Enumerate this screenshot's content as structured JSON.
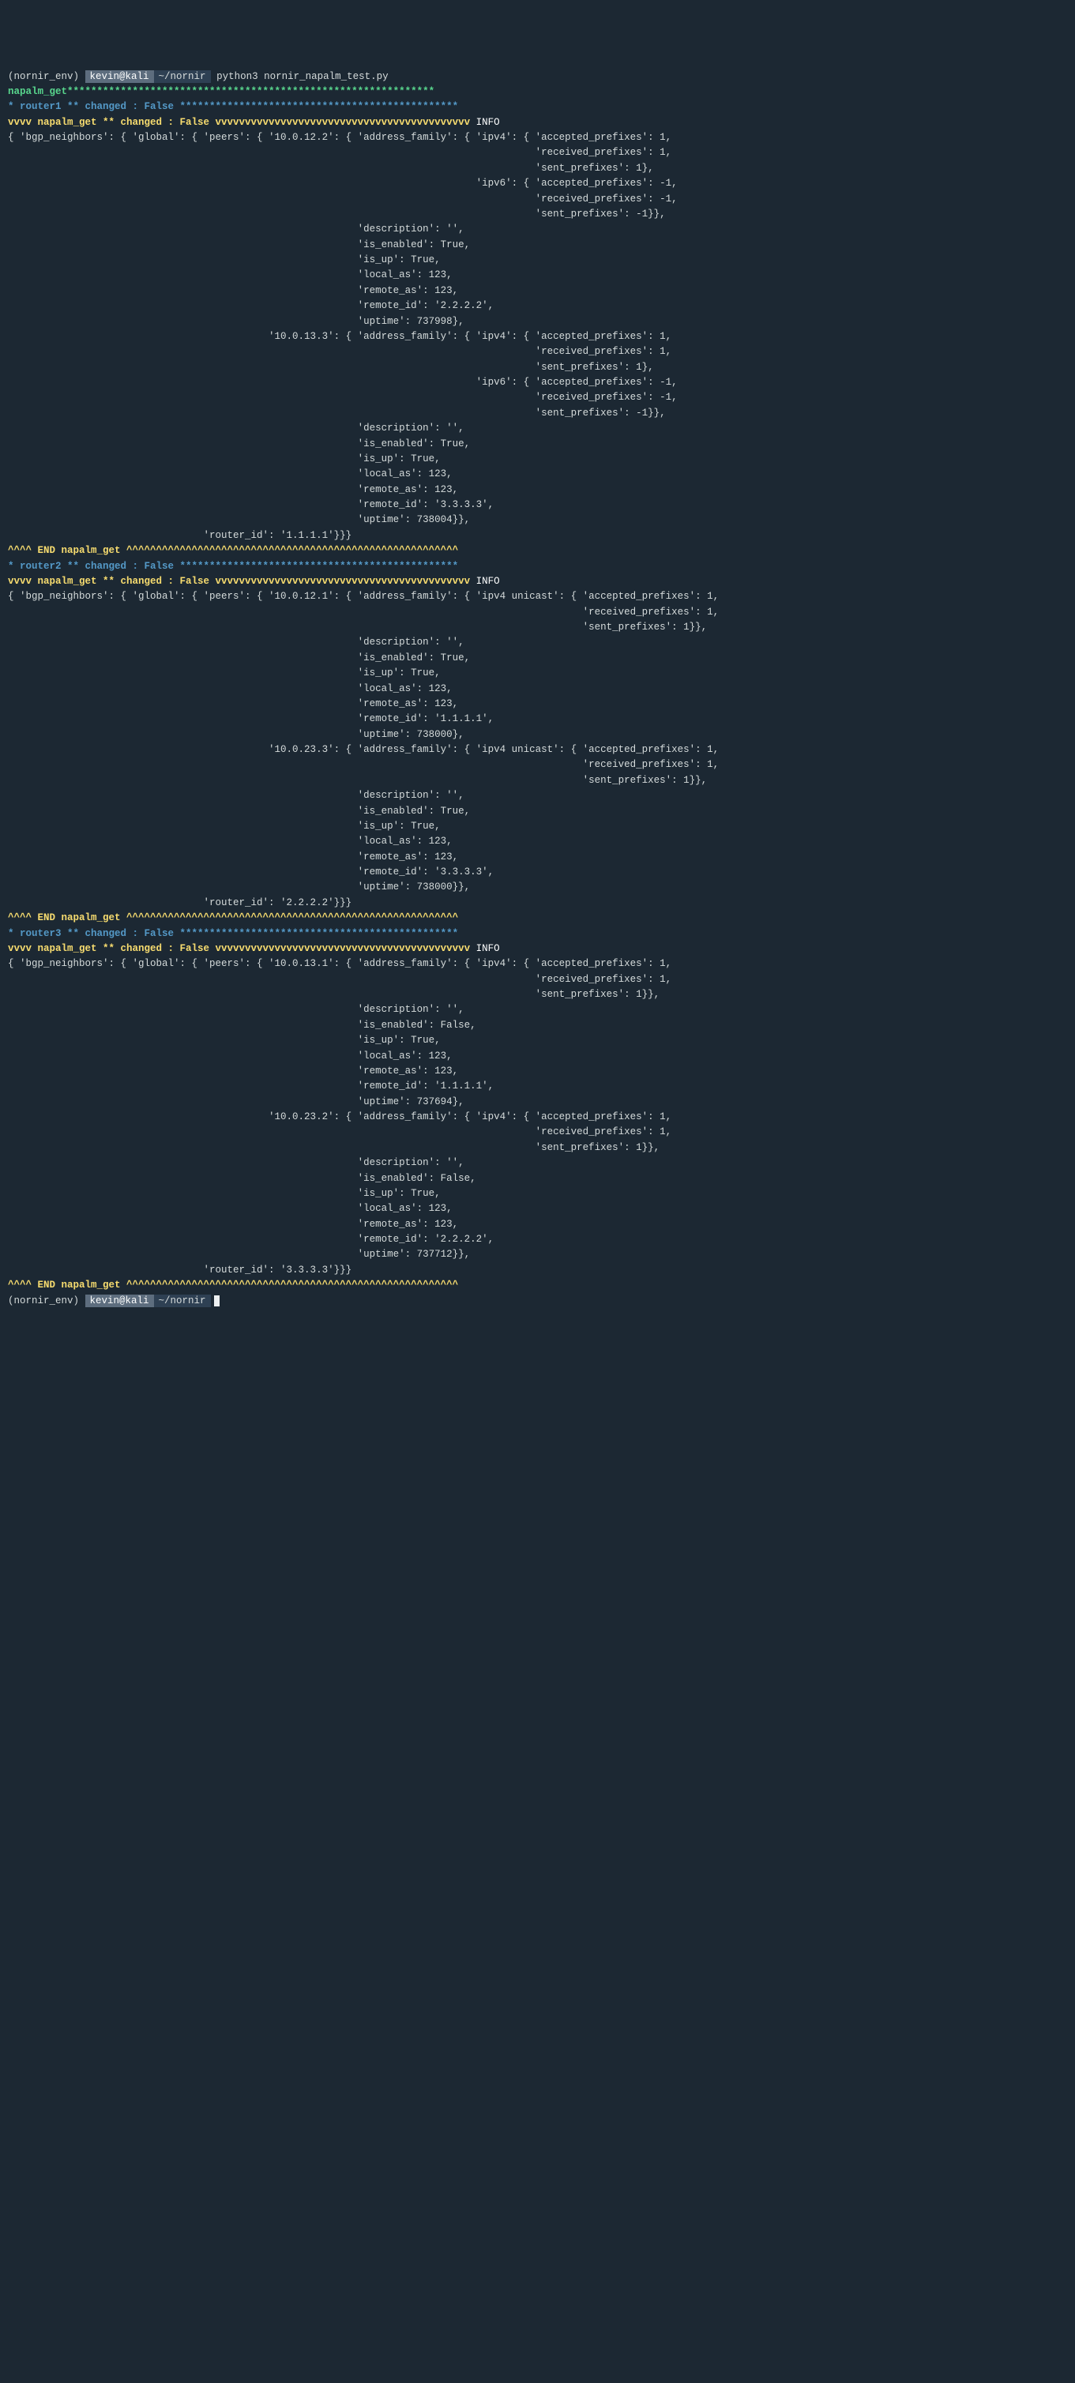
{
  "prompt": {
    "env": "(nornir_env)",
    "user": "kevin@kali",
    "path": "~/nornir",
    "command": "python3 nornir_napalm_test.py"
  },
  "sep": {
    "header_stars": "napalm_get**************************************************************",
    "r1_stars": "* router1 ** changed : False ***********************************************",
    "r2_stars": "* router2 ** changed : False ***********************************************",
    "r3_stars": "* router3 ** changed : False ***********************************************",
    "vvvv_line": "vvvv napalm_get ** changed : False vvvvvvvvvvvvvvvvvvvvvvvvvvvvvvvvvvvvvvvvvvv",
    "info": "INFO",
    "end_line": "^^^^ END napalm_get ^^^^^^^^^^^^^^^^^^^^^^^^^^^^^^^^^^^^^^^^^^^^^^^^^^^^^^^^"
  },
  "router1": {
    "l01": "{ 'bgp_neighbors': { 'global': { 'peers': { '10.0.12.2': { 'address_family': { 'ipv4': { 'accepted_prefixes': 1,",
    "l02": "                                                                                         'received_prefixes': 1,",
    "l03": "                                                                                         'sent_prefixes': 1},",
    "l04": "                                                                               'ipv6': { 'accepted_prefixes': -1,",
    "l05": "                                                                                         'received_prefixes': -1,",
    "l06": "                                                                                         'sent_prefixes': -1}},",
    "l07": "                                                           'description': '',",
    "l08": "                                                           'is_enabled': True,",
    "l09": "                                                           'is_up': True,",
    "l10": "                                                           'local_as': 123,",
    "l11": "                                                           'remote_as': 123,",
    "l12": "                                                           'remote_id': '2.2.2.2',",
    "l13": "                                                           'uptime': 737998},",
    "l14": "                                            '10.0.13.3': { 'address_family': { 'ipv4': { 'accepted_prefixes': 1,",
    "l15": "                                                                                         'received_prefixes': 1,",
    "l16": "                                                                                         'sent_prefixes': 1},",
    "l17": "                                                                               'ipv6': { 'accepted_prefixes': -1,",
    "l18": "                                                                                         'received_prefixes': -1,",
    "l19": "                                                                                         'sent_prefixes': -1}},",
    "l20": "                                                           'description': '',",
    "l21": "                                                           'is_enabled': True,",
    "l22": "                                                           'is_up': True,",
    "l23": "                                                           'local_as': 123,",
    "l24": "                                                           'remote_as': 123,",
    "l25": "                                                           'remote_id': '3.3.3.3',",
    "l26": "                                                           'uptime': 738004}},",
    "l27": "                                 'router_id': '1.1.1.1'}}}"
  },
  "router2": {
    "l01": "{ 'bgp_neighbors': { 'global': { 'peers': { '10.0.12.1': { 'address_family': { 'ipv4 unicast': { 'accepted_prefixes': 1,",
    "l02": "                                                                                                 'received_prefixes': 1,",
    "l03": "                                                                                                 'sent_prefixes': 1}},",
    "l04": "                                                           'description': '',",
    "l05": "                                                           'is_enabled': True,",
    "l06": "                                                           'is_up': True,",
    "l07": "                                                           'local_as': 123,",
    "l08": "                                                           'remote_as': 123,",
    "l09": "                                                           'remote_id': '1.1.1.1',",
    "l10": "                                                           'uptime': 738000},",
    "l11": "                                            '10.0.23.3': { 'address_family': { 'ipv4 unicast': { 'accepted_prefixes': 1,",
    "l12": "                                                                                                 'received_prefixes': 1,",
    "l13": "                                                                                                 'sent_prefixes': 1}},",
    "l14": "                                                           'description': '',",
    "l15": "                                                           'is_enabled': True,",
    "l16": "                                                           'is_up': True,",
    "l17": "                                                           'local_as': 123,",
    "l18": "                                                           'remote_as': 123,",
    "l19": "                                                           'remote_id': '3.3.3.3',",
    "l20": "                                                           'uptime': 738000}},",
    "l21": "                                 'router_id': '2.2.2.2'}}}"
  },
  "router3": {
    "l01": "{ 'bgp_neighbors': { 'global': { 'peers': { '10.0.13.1': { 'address_family': { 'ipv4': { 'accepted_prefixes': 1,",
    "l02": "                                                                                         'received_prefixes': 1,",
    "l03": "                                                                                         'sent_prefixes': 1}},",
    "l04": "                                                           'description': '',",
    "l05": "                                                           'is_enabled': False,",
    "l06": "                                                           'is_up': True,",
    "l07": "                                                           'local_as': 123,",
    "l08": "                                                           'remote_as': 123,",
    "l09": "                                                           'remote_id': '1.1.1.1',",
    "l10": "                                                           'uptime': 737694},",
    "l11": "                                            '10.0.23.2': { 'address_family': { 'ipv4': { 'accepted_prefixes': 1,",
    "l12": "                                                                                         'received_prefixes': 1,",
    "l13": "                                                                                         'sent_prefixes': 1}},",
    "l14": "                                                           'description': '',",
    "l15": "                                                           'is_enabled': False,",
    "l16": "                                                           'is_up': True,",
    "l17": "                                                           'local_as': 123,",
    "l18": "                                                           'remote_as': 123,",
    "l19": "                                                           'remote_id': '2.2.2.2',",
    "l20": "                                                           'uptime': 737712}},",
    "l21": "                                 'router_id': '3.3.3.3'}}}"
  }
}
